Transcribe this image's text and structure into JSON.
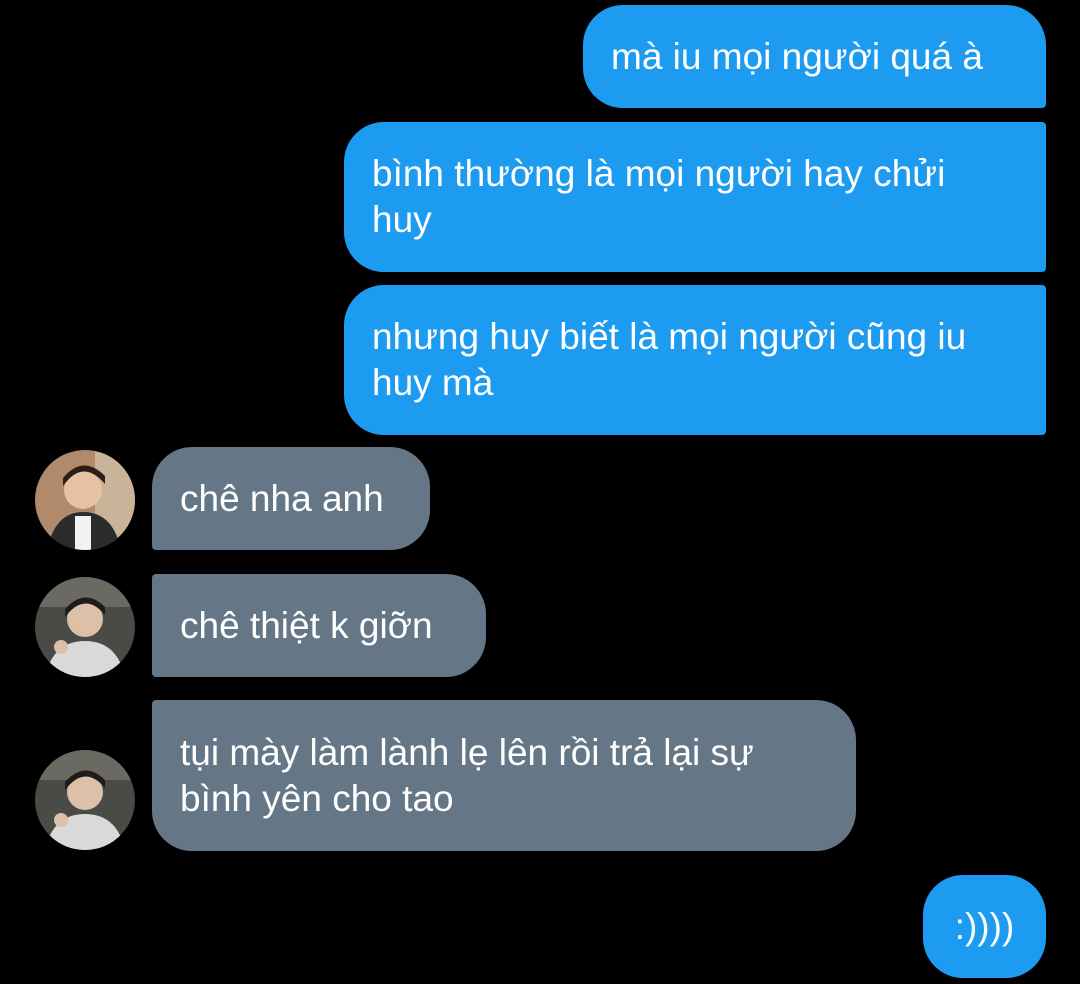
{
  "conversation": {
    "colors": {
      "background": "#000000",
      "outgoing_bubble": "#1d9bf0",
      "incoming_bubble": "#657786",
      "text": "#ffffff"
    },
    "messages": [
      {
        "direction": "outgoing",
        "text": "mà iu mọi người quá à"
      },
      {
        "direction": "outgoing",
        "text": "bình thường là mọi người hay chửi huy"
      },
      {
        "direction": "outgoing",
        "text": "nhưng huy biết là mọi người cũng iu huy mà"
      },
      {
        "direction": "incoming",
        "avatar": "user-avatar-1",
        "text": "chê nha anh"
      },
      {
        "direction": "incoming",
        "avatar": "user-avatar-2",
        "text": "chê thiệt k giỡn"
      },
      {
        "direction": "incoming",
        "avatar": "user-avatar-2",
        "text": "tụi mày làm lành lẹ lên rồi trả lại sự bình yên cho tao"
      },
      {
        "direction": "outgoing",
        "text": ":))))"
      }
    ]
  }
}
